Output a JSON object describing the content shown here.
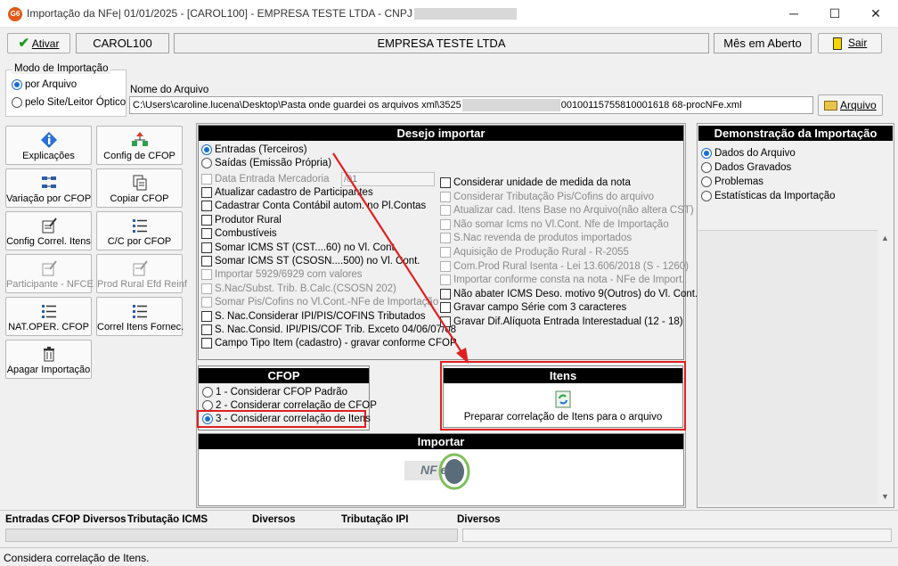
{
  "window": {
    "title_prefix": "Importação da NFe|  01/01/2025 - [CAROL100] - EMPRESA TESTE LTDA - CNPJ",
    "app_badge": "G6",
    "controls": {
      "minimize": "─",
      "maximize": "☐",
      "close": "✕"
    }
  },
  "toolbar": {
    "activate_label": "Ativar",
    "user_code": "CAROL100",
    "company": "EMPRESA TESTE LTDA",
    "period_status": "Mês em Aberto",
    "exit_label": "Sair"
  },
  "import_mode": {
    "legend": "Modo de Importação",
    "options": [
      "por Arquivo",
      "pelo Site/Leitor Óptico"
    ],
    "selected": 0
  },
  "file": {
    "label": "Nome do Arquivo",
    "path_start": "C:\\Users\\caroline.lucena\\Desktop\\Pasta onde guardei os arquivos xml\\3525",
    "path_end": "00100115755810001618 68-procNFe.xml",
    "button_label": "Arquivo"
  },
  "tools": [
    {
      "label": "Explicações",
      "icon": "info-icon",
      "enabled": true
    },
    {
      "label": "Config de CFOP",
      "icon": "tree-icon",
      "enabled": true
    },
    {
      "label": "Variação por CFOP",
      "icon": "grid-icon",
      "enabled": true
    },
    {
      "label": "Copiar CFOP",
      "icon": "copy-icon",
      "enabled": true
    },
    {
      "label": "Config Correl. Itens",
      "icon": "edit-icon",
      "enabled": true
    },
    {
      "label": "C/C por CFOP",
      "icon": "list-icon",
      "enabled": true
    },
    {
      "label": "Participante - NFCE",
      "icon": "edit-icon",
      "enabled": false
    },
    {
      "label": "Prod Rural Efd Reinf",
      "icon": "edit-icon",
      "enabled": false
    },
    {
      "label": "NAT.OPER. CFOP",
      "icon": "list-icon",
      "enabled": true
    },
    {
      "label": "Correl Itens Fornec.",
      "icon": "list-icon",
      "enabled": true
    },
    {
      "label": "Apagar Importação",
      "icon": "trash-icon",
      "enabled": true
    }
  ],
  "desejo": {
    "header": "Desejo importar",
    "direction_options": [
      "Entradas (Terceiros)",
      "Saídas (Emissão Própria)"
    ],
    "direction_selected": 0,
    "date_label": "Data Entrada Mercadoria",
    "date_value": "/01",
    "left_checks": [
      {
        "label": "Atualizar cadastro de Participantes",
        "enabled": true
      },
      {
        "label": "Cadastrar Conta Contábil autom. no Pl.Contas",
        "enabled": true
      },
      {
        "label": "Produtor Rural",
        "enabled": true
      },
      {
        "label": "Combustíveis",
        "enabled": true
      },
      {
        "label": "Somar ICMS ST (CST....60) no Vl. Cont.",
        "enabled": true
      },
      {
        "label": "Somar ICMS ST (CSOSN....500) no Vl. Cont.",
        "enabled": true
      },
      {
        "label": "Importar 5929/6929 com valores",
        "enabled": false
      },
      {
        "label": "S.Nac/Subst. Trib. B.Calc.(CSOSN 202)",
        "enabled": false
      },
      {
        "label": "Somar Pis/Cofins no Vl.Cont.-NFe de Importação",
        "enabled": false
      },
      {
        "label": "S. Nac.Considerar IPI/PIS/COFINS Tributados",
        "enabled": true
      },
      {
        "label": "S. Nac.Consid. IPI/PIS/COF Trib. Exceto 04/06/07/08",
        "enabled": true
      },
      {
        "label": "Campo Tipo Item (cadastro) - gravar conforme CFOP",
        "enabled": true
      }
    ],
    "right_checks": [
      {
        "label": "Considerar unidade de medida da nota",
        "enabled": true
      },
      {
        "label": "Considerar Tributação Pis/Cofins do arquivo",
        "enabled": false
      },
      {
        "label": "Atualizar cad. Itens Base no Arquivo(não altera CST)",
        "enabled": false
      },
      {
        "label": "Não somar Icms no Vl.Cont. Nfe de Importação",
        "enabled": false
      },
      {
        "label": "S.Nac revenda de produtos importados",
        "enabled": false
      },
      {
        "label": "Aquisição de Produção Rural - R-2055",
        "enabled": false
      },
      {
        "label": "Com.Prod Rural Isenta - Lei 13.606/2018 (S - 1260)",
        "enabled": false
      },
      {
        "label": "Importar conforme consta na nota - NFe de Import.",
        "enabled": false
      },
      {
        "label": "Não abater ICMS Deso. motivo 9(Outros) do Vl. Cont.",
        "enabled": true
      },
      {
        "label": "Gravar campo Série com 3 caracteres",
        "enabled": true
      },
      {
        "label": "Gravar Dif.Alíquota Entrada Interestadual (12 - 18)",
        "enabled": true
      }
    ]
  },
  "cfop": {
    "header": "CFOP",
    "options": [
      "1 - Considerar CFOP Padrão",
      "2 - Considerar correlação de CFOP",
      "3 - Considerar correlação de Itens"
    ],
    "selected": 2
  },
  "itens": {
    "header": "Itens",
    "action_label": "Preparar correlação de Itens para o arquivo"
  },
  "importar": {
    "header": "Importar",
    "logo_text": "NF e"
  },
  "demo": {
    "header": "Demonstração da Importação",
    "options": [
      "Dados do Arquivo",
      "Dados Gravados",
      "Problemas",
      "Estatísticas da Importação"
    ],
    "selected": 0
  },
  "bottom": {
    "columns": [
      "Entradas",
      "CFOP",
      "Diversos",
      "Tributação ICMS",
      "Diversos",
      "Tributação IPI",
      "Diversos"
    ]
  },
  "statusbar": {
    "message": "Considera correlação de Itens."
  }
}
